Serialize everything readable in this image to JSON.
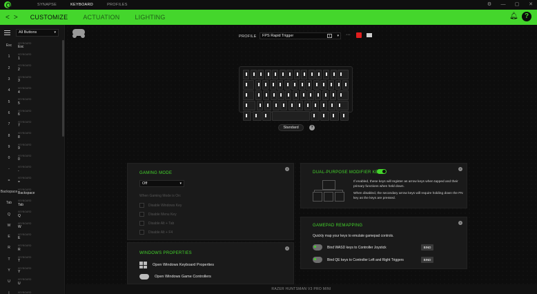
{
  "titlebar": {
    "tabs": [
      "SYNAPSE",
      "KEYBOARD",
      "PROFILES"
    ],
    "active_tab": "KEYBOARD",
    "controls": [
      "⚙",
      "—",
      "▢",
      "✕"
    ]
  },
  "nav": {
    "back": "<",
    "forward": ">",
    "subtabs": [
      "CUSTOMIZE",
      "ACTUATION",
      "LIGHTING"
    ],
    "active": "CUSTOMIZE"
  },
  "sidebar": {
    "filter": "All Buttons",
    "caret": "▾",
    "items": [
      {
        "key": "Esc",
        "group": "KEYBOARD",
        "value": "Esc"
      },
      {
        "key": "1",
        "group": "KEYBOARD",
        "value": "1"
      },
      {
        "key": "2",
        "group": "KEYBOARD",
        "value": "2"
      },
      {
        "key": "3",
        "group": "KEYBOARD",
        "value": "3"
      },
      {
        "key": "4",
        "group": "KEYBOARD",
        "value": "4"
      },
      {
        "key": "5",
        "group": "KEYBOARD",
        "value": "5"
      },
      {
        "key": "6",
        "group": "KEYBOARD",
        "value": "6"
      },
      {
        "key": "7",
        "group": "KEYBOARD",
        "value": "7"
      },
      {
        "key": "8",
        "group": "KEYBOARD",
        "value": "8"
      },
      {
        "key": "9",
        "group": "KEYBOARD",
        "value": "9"
      },
      {
        "key": "0",
        "group": "KEYBOARD",
        "value": "0"
      },
      {
        "key": "-",
        "group": "KEYBOARD",
        "value": "-"
      },
      {
        "key": "=",
        "group": "KEYBOARD",
        "value": "="
      },
      {
        "key": "Backspace",
        "group": "KEYBOARD",
        "value": "Backspace"
      },
      {
        "key": "Tab",
        "group": "KEYBOARD",
        "value": "Tab"
      },
      {
        "key": "Q",
        "group": "KEYBOARD",
        "value": "Q"
      },
      {
        "key": "W",
        "group": "KEYBOARD",
        "value": "W"
      },
      {
        "key": "E",
        "group": "KEYBOARD",
        "value": "E"
      },
      {
        "key": "R",
        "group": "KEYBOARD",
        "value": "R"
      },
      {
        "key": "T",
        "group": "KEYBOARD",
        "value": "T"
      },
      {
        "key": "Y",
        "group": "KEYBOARD",
        "value": "Y"
      },
      {
        "key": "U",
        "group": "KEYBOARD",
        "value": "U"
      },
      {
        "key": "I",
        "group": "KEYBOARD",
        "value": ""
      }
    ]
  },
  "profile": {
    "label": "PROFILE",
    "value": "FPS Rapid Trigger",
    "number": "1",
    "caret": "▾",
    "more": "···"
  },
  "keyboard_mode": {
    "pill": "Standard",
    "info": "?"
  },
  "gaming_mode": {
    "title": "GAMING MODE",
    "info": "i",
    "select_value": "Off",
    "caret": "▾",
    "when_label": "When Gaming Mode is On:",
    "options": [
      "Disable Windows Key",
      "Disable Menu Key",
      "Disable Alt + Tab",
      "Disable Alt + F4"
    ]
  },
  "windows_properties": {
    "title": "WINDOWS PROPERTIES",
    "info": "i",
    "links": [
      "Open Windows Keyboard Properties",
      "Open Windows Game Controllers"
    ]
  },
  "dual_purpose": {
    "title": "DUAL-PURPOSE MODIFIER KEYS",
    "info": "i",
    "enabled": true,
    "desc1": "If enabled, these keys will register as arrow keys when tapped and their primary functions when held down.",
    "desc2": "When disabled, the secondary arrow keys will require holding down the FN key as the keys are pressed."
  },
  "gamepad": {
    "title": "GAMEPAD REMAPPING",
    "info": "i",
    "subtitle": "Quickly map your keys to emulate gamepad controls.",
    "rows": [
      {
        "label": "Bind WASD keys to Controller Joystick",
        "button": "BIND"
      },
      {
        "label": "Bind QE keys to Controller Left and Right Triggers",
        "button": "BIND"
      }
    ]
  },
  "footer": {
    "device": "RAZER HUNTSMAN V3 PRO MINI"
  },
  "colors": {
    "accent": "#44d62c",
    "record": "#e01e1e",
    "background": "#0b0b0b"
  }
}
